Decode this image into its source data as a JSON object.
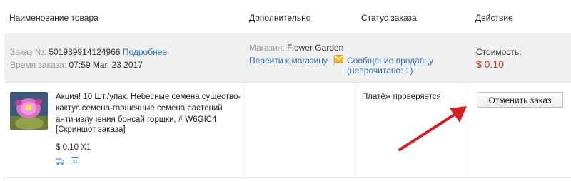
{
  "table": {
    "headers": {
      "product": "Наименование товара",
      "extra": "Дополнительно",
      "status": "Статус заказа",
      "action": "Действие"
    }
  },
  "order": {
    "number_label": "Заказ №:",
    "number": "501989914124966",
    "details_link": "Подробнее",
    "time_label": "Время заказа:",
    "time": "07:59 Mar. 23 2017",
    "store_label": "Магазин:",
    "store_name": "Flower Garden",
    "go_to_store": "Перейти к магазину",
    "separator": "|",
    "message_seller": "Сообщение продавцу",
    "unread": "(непрочитано: 1)",
    "cost_label": "Стоимость:",
    "cost": "$ 0.10"
  },
  "item": {
    "title": "Акция! 10 Шт./упак. Небесные семена существо-кактус семена-горшечные семена растений анти-излучения бонсай горшки, # W6GIC4",
    "snapshot": "[Скриншот заказа]",
    "price_qty": "$ 0.10 X1",
    "status": "Платёж проверяется",
    "cancel_button": "Отменить заказ"
  },
  "colors": {
    "link": "#2d6fb8",
    "price": "#c6391a",
    "arrow": "#d32026",
    "info_row_bg": "#f0f0f0"
  },
  "icons": [
    "mail-icon",
    "truck-icon",
    "document-icon",
    "red-arrow-annotation"
  ]
}
